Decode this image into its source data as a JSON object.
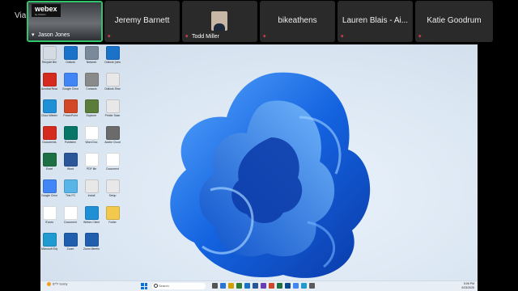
{
  "app": {
    "via_label": "Via"
  },
  "participants": [
    {
      "name": "Jason Jones",
      "type": "self-video"
    },
    {
      "name": "Jeremy Barnett",
      "type": "name"
    },
    {
      "name": "Todd Miller",
      "type": "photo"
    },
    {
      "name": "bikeathens",
      "type": "name"
    },
    {
      "name": "Lauren Blais - Ai...",
      "type": "name"
    },
    {
      "name": "Katie Goodrum",
      "type": "name"
    }
  ],
  "logo": {
    "name": "webex",
    "sub": "by CISCO"
  },
  "desktop_icons": [
    {
      "label": "Recycle Bin",
      "color": "#d5dbe2"
    },
    {
      "label": "Outlook",
      "color": "#1a73c8"
    },
    {
      "label": "Network",
      "color": "#7a8a9a"
    },
    {
      "label": "Outlook (new)",
      "color": "#1a73c8"
    },
    {
      "label": "Acrobat Reader",
      "color": "#d42b1e"
    },
    {
      "label": "Google Chrome",
      "color": "#4285f4"
    },
    {
      "label": "Contacts",
      "color": "#8a8a8a"
    },
    {
      "label": "Outlook Shortcut",
      "color": "#e8e8e8"
    },
    {
      "label": "Cisco Webex",
      "color": "#1f8fd6"
    },
    {
      "label": "PowerPoint",
      "color": "#d24726"
    },
    {
      "label": "Explorer",
      "color": "#5b7d3a"
    },
    {
      "label": "Printer Scan",
      "color": "#e8e8e8"
    },
    {
      "label": "Documents",
      "color": "#d42b1e"
    },
    {
      "label": "Publisher",
      "color": "#077568"
    },
    {
      "label": "Word Doc",
      "color": "#ffffff"
    },
    {
      "label": "Adobe Cloud",
      "color": "#6b6b6b"
    },
    {
      "label": "Excel",
      "color": "#1d7044"
    },
    {
      "label": "Word",
      "color": "#2b579a"
    },
    {
      "label": "PDF file",
      "color": "#ffffff"
    },
    {
      "label": "Document",
      "color": "#ffffff"
    },
    {
      "label": "Google Chrome",
      "color": "#4285f4"
    },
    {
      "label": "This PC",
      "color": "#59b4e8"
    },
    {
      "label": "Install",
      "color": "#e8e8e8"
    },
    {
      "label": "Setup",
      "color": "#e8e8e8"
    },
    {
      "label": "iTunes",
      "color": "#ffffff"
    },
    {
      "label": "Document",
      "color": "#ffffff"
    },
    {
      "label": "Webex Client",
      "color": "#1f8fd6"
    },
    {
      "label": "Folder",
      "color": "#f2c94c"
    },
    {
      "label": "Microsoft Edge",
      "color": "#1f9bd1"
    },
    {
      "label": "Zoom",
      "color": "#1f5fae"
    },
    {
      "label": "Zoom Meeting",
      "color": "#1f5fae"
    }
  ],
  "taskbar": {
    "weather_temp": "87°F",
    "weather_desc": "Sunny",
    "search_placeholder": "Search",
    "time": "5:06 PM",
    "date": "9/23/2025",
    "apps": [
      "#555",
      "#2b73d4",
      "#d0a000",
      "#2e7d32",
      "#1a73c8",
      "#2b579a",
      "#6a3fb5",
      "#d24726",
      "#1d7044",
      "#0a4b8c",
      "#4285f4",
      "#1f9bd1",
      "#5b5b5b"
    ]
  }
}
